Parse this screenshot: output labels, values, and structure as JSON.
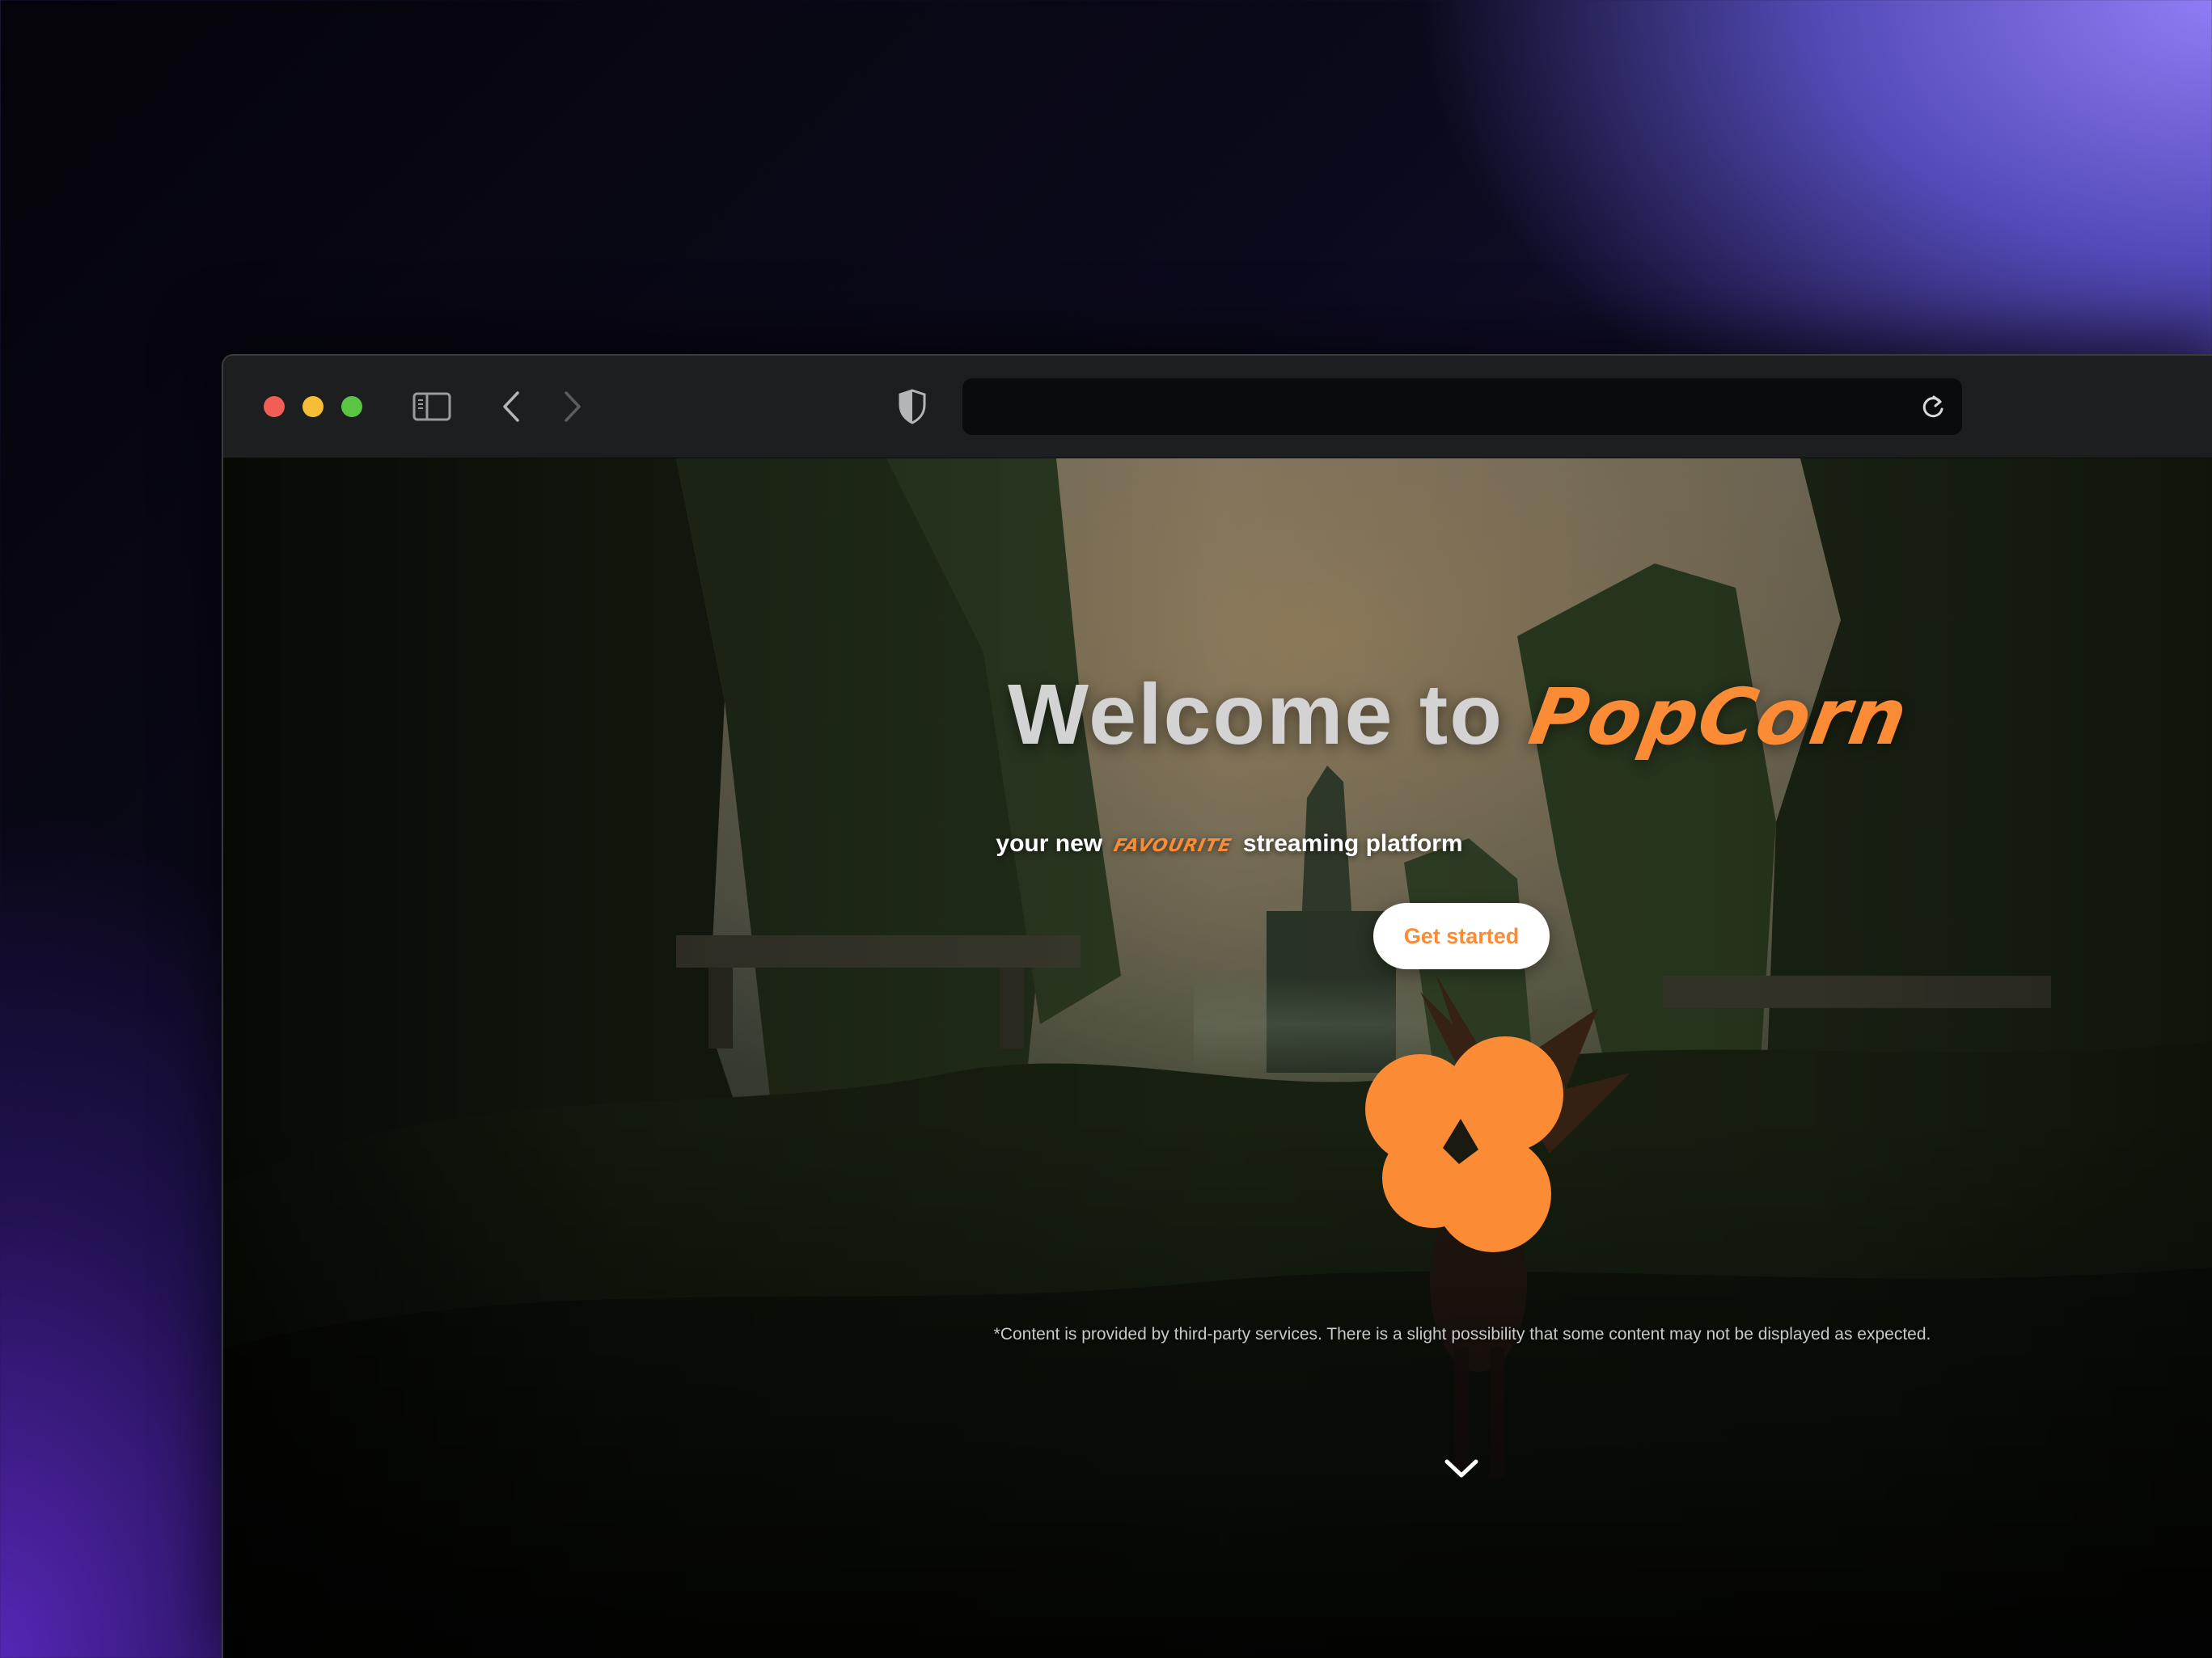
{
  "browser": {
    "address_text": "",
    "icons": {
      "sidebar": "sidebar-toggle-icon",
      "back": "chevron-left-icon",
      "forward": "chevron-right-icon",
      "privacy": "shield-icon",
      "reload": "reload-icon"
    }
  },
  "hero": {
    "title_prefix": "Welcome to",
    "brand": "PopCorn",
    "subtitle_before": "your new",
    "subtitle_highlight": "FAVOURITE",
    "subtitle_after": "streaming platform",
    "cta_label": "Get started",
    "disclaimer": "*Content is provided by third-party services. There is a slight possibility that some content may not be displayed as expected.",
    "scroll_icon": "chevron-down-icon"
  },
  "colors": {
    "brand_orange": "#fb8b35",
    "title_gray": "#d3d3d3",
    "cta_bg": "#ffffff",
    "traffic_red": "#f05e56",
    "traffic_yellow": "#f6bd37",
    "traffic_green": "#5ac443"
  }
}
